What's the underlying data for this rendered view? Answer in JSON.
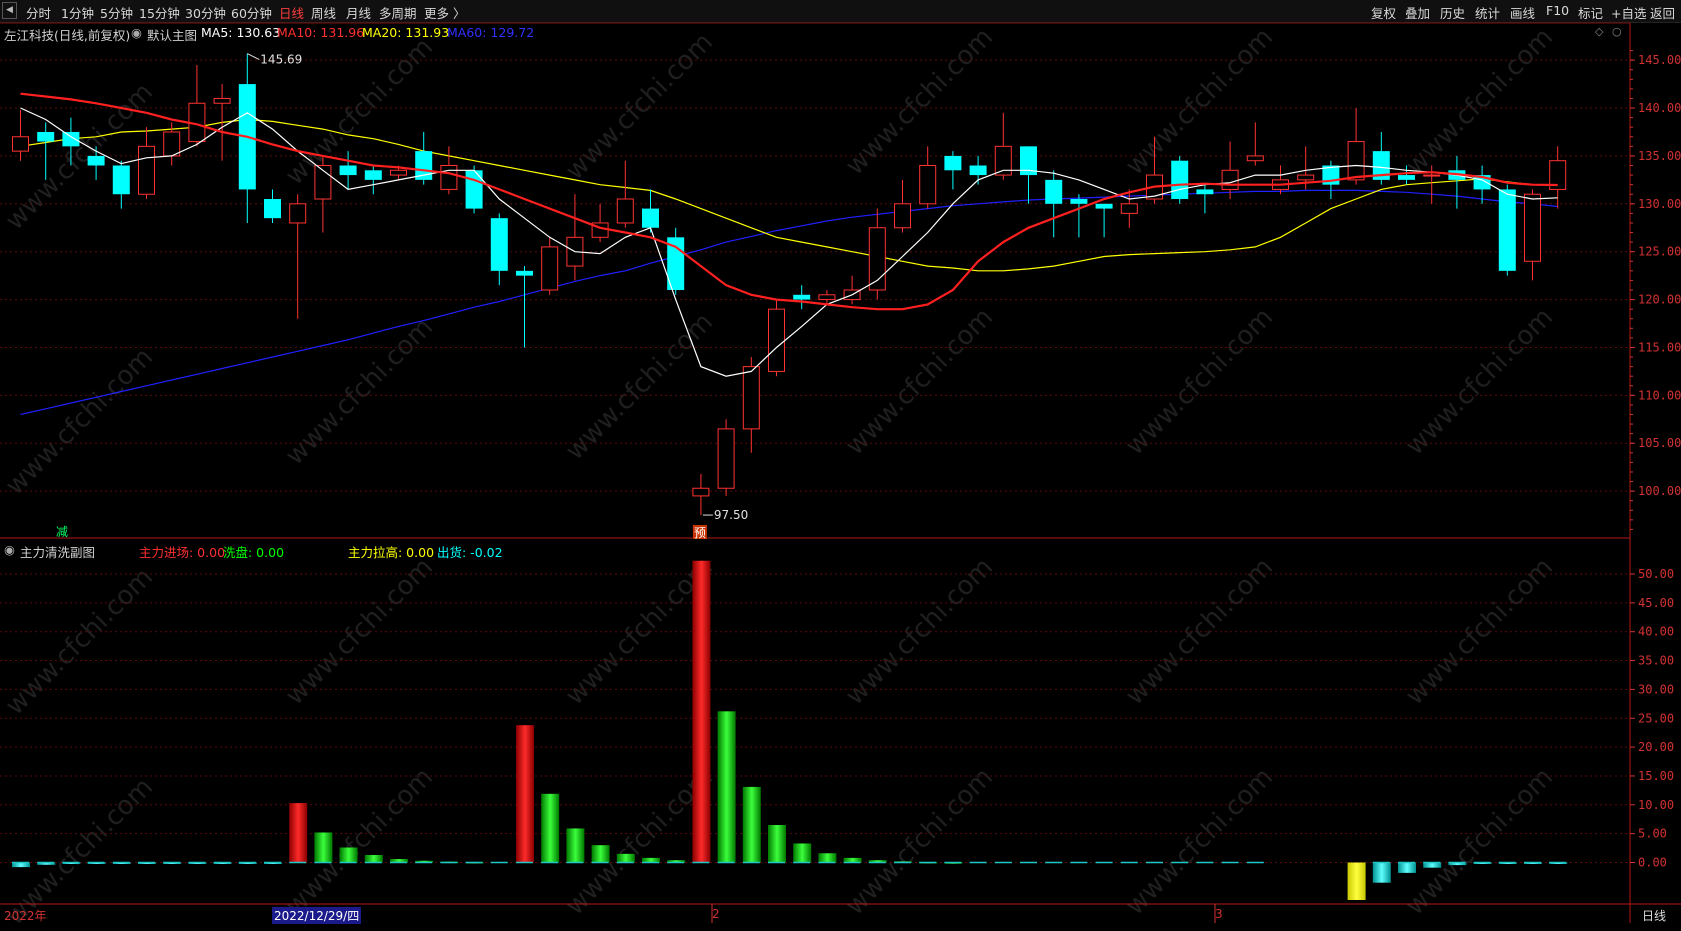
{
  "toolbar": {
    "periods": [
      "分时",
      "1分钟",
      "5分钟",
      "15分钟",
      "30分钟",
      "60分钟",
      "日线",
      "周线",
      "月线",
      "多周期",
      "更多 〉"
    ],
    "active_period": "日线",
    "right_buttons": [
      "复权",
      "叠加",
      "历史",
      "统计",
      "画线",
      "F10",
      "标记",
      "+自选",
      "返回"
    ]
  },
  "main_legend": {
    "title": "左江科技(日线,前复权)",
    "indicator_name": "默认主图",
    "ma5": "MA5: 130.63",
    "ma10": "MA10: 131.96",
    "ma20": "MA20: 131.93",
    "ma60": "MA60: 129.72"
  },
  "sub_legend": {
    "name": "主力清洗副图",
    "enter": "主力进场: 0.00",
    "wash": "洗盘: 0.00",
    "pull": "主力拉高: 0.00",
    "ship": "出货: -0.02"
  },
  "annotations": {
    "high": "145.69",
    "low": "97.50",
    "marker_reduce": "减",
    "marker_pre": "预"
  },
  "bottom_bar": {
    "year": "2022年",
    "selected_date": "2022/12/29/四",
    "month2": "2",
    "month3": "3",
    "period": "日线"
  },
  "colors": {
    "up": "#ff3232",
    "down": "#00ffff",
    "ma5": "#ffffff",
    "ma10": "#ff2020",
    "ma20": "#ffff00",
    "ma60": "#2020ff",
    "green_bar": "#00e000",
    "yellow_bar": "#ffff00",
    "axis": "#d23232"
  },
  "watermark": "www.cfchi.com",
  "chart_data": [
    {
      "type": "candlestick",
      "title": "左江科技(日线,前复权)",
      "ylim": [
        95,
        147
      ],
      "y_ticks": [
        100.0,
        105.0,
        110.0,
        115.0,
        120.0,
        125.0,
        130.0,
        135.0,
        140.0,
        145.0
      ],
      "candles": [
        {
          "o": 135.5,
          "c": 137.0,
          "h": 139.8,
          "l": 134.5
        },
        {
          "o": 137.5,
          "c": 136.5,
          "h": 138.5,
          "l": 132.5
        },
        {
          "o": 137.5,
          "c": 136.0,
          "h": 139.0,
          "l": 134.0
        },
        {
          "o": 135.0,
          "c": 134.0,
          "h": 136.0,
          "l": 132.5
        },
        {
          "o": 134.0,
          "c": 131.0,
          "h": 134.5,
          "l": 129.5
        },
        {
          "o": 131.0,
          "c": 136.0,
          "h": 138.0,
          "l": 130.5
        },
        {
          "o": 135.0,
          "c": 137.5,
          "h": 138.5,
          "l": 134.0
        },
        {
          "o": 136.5,
          "c": 140.5,
          "h": 144.5,
          "l": 136.0
        },
        {
          "o": 140.5,
          "c": 141.0,
          "h": 142.5,
          "l": 134.5
        },
        {
          "o": 142.5,
          "c": 131.5,
          "h": 145.69,
          "l": 128.0
        },
        {
          "o": 130.5,
          "c": 128.5,
          "h": 131.5,
          "l": 128.0
        },
        {
          "o": 128.0,
          "c": 130.0,
          "h": 131.0,
          "l": 118.0
        },
        {
          "o": 130.5,
          "c": 134.0,
          "h": 135.0,
          "l": 127.0
        },
        {
          "o": 134.0,
          "c": 133.0,
          "h": 135.5,
          "l": 131.5
        },
        {
          "o": 133.5,
          "c": 132.5,
          "h": 134.0,
          "l": 131.0
        },
        {
          "o": 133.0,
          "c": 133.5,
          "h": 134.0,
          "l": 132.5
        },
        {
          "o": 135.5,
          "c": 132.5,
          "h": 137.5,
          "l": 132.0
        },
        {
          "o": 131.5,
          "c": 134.0,
          "h": 136.0,
          "l": 131.0
        },
        {
          "o": 133.5,
          "c": 129.5,
          "h": 134.0,
          "l": 129.0
        },
        {
          "o": 128.5,
          "c": 123.0,
          "h": 129.0,
          "l": 121.5
        },
        {
          "o": 123.0,
          "c": 122.5,
          "h": 123.5,
          "l": 115.0
        },
        {
          "o": 121.0,
          "c": 125.5,
          "h": 126.5,
          "l": 120.5
        },
        {
          "o": 123.5,
          "c": 126.5,
          "h": 131.0,
          "l": 122.0
        },
        {
          "o": 126.5,
          "c": 128.0,
          "h": 130.0,
          "l": 126.0
        },
        {
          "o": 128.0,
          "c": 130.5,
          "h": 134.5,
          "l": 127.5
        },
        {
          "o": 129.5,
          "c": 127.5,
          "h": 131.5,
          "l": 127.0
        },
        {
          "o": 126.5,
          "c": 121.0,
          "h": 127.5,
          "l": 120.5
        },
        {
          "o": 99.5,
          "c": 100.3,
          "h": 101.8,
          "l": 97.5
        },
        {
          "o": 100.3,
          "c": 106.5,
          "h": 107.5,
          "l": 99.5
        },
        {
          "o": 106.5,
          "c": 113.0,
          "h": 114.0,
          "l": 104.0
        },
        {
          "o": 112.5,
          "c": 119.0,
          "h": 120.0,
          "l": 112.0
        },
        {
          "o": 120.5,
          "c": 120.0,
          "h": 121.5,
          "l": 119.0
        },
        {
          "o": 120.0,
          "c": 120.5,
          "h": 121.0,
          "l": 119.5
        },
        {
          "o": 120.0,
          "c": 121.0,
          "h": 122.5,
          "l": 119.5
        },
        {
          "o": 121.0,
          "c": 127.5,
          "h": 129.5,
          "l": 120.0
        },
        {
          "o": 127.5,
          "c": 130.0,
          "h": 132.5,
          "l": 127.0
        },
        {
          "o": 130.0,
          "c": 134.0,
          "h": 136.0,
          "l": 129.5
        },
        {
          "o": 135.0,
          "c": 133.5,
          "h": 135.5,
          "l": 131.5
        },
        {
          "o": 134.0,
          "c": 133.0,
          "h": 135.0,
          "l": 132.0
        },
        {
          "o": 133.0,
          "c": 136.0,
          "h": 139.5,
          "l": 132.5
        },
        {
          "o": 136.0,
          "c": 133.0,
          "h": 136.0,
          "l": 130.0
        },
        {
          "o": 132.5,
          "c": 130.0,
          "h": 133.5,
          "l": 126.5
        },
        {
          "o": 130.5,
          "c": 130.0,
          "h": 131.0,
          "l": 126.5
        },
        {
          "o": 130.0,
          "c": 129.5,
          "h": 130.0,
          "l": 126.5
        },
        {
          "o": 129.0,
          "c": 130.0,
          "h": 131.5,
          "l": 127.5
        },
        {
          "o": 130.5,
          "c": 133.0,
          "h": 137.0,
          "l": 130.0
        },
        {
          "o": 134.5,
          "c": 130.5,
          "h": 135.0,
          "l": 130.0
        },
        {
          "o": 131.5,
          "c": 131.0,
          "h": 132.0,
          "l": 129.0
        },
        {
          "o": 131.5,
          "c": 133.5,
          "h": 136.5,
          "l": 130.5
        },
        {
          "o": 134.5,
          "c": 135.0,
          "h": 138.5,
          "l": 134.0
        },
        {
          "o": 131.5,
          "c": 132.5,
          "h": 134.0,
          "l": 131.0
        },
        {
          "o": 132.5,
          "c": 133.0,
          "h": 136.0,
          "l": 131.5
        },
        {
          "o": 134.0,
          "c": 132.0,
          "h": 134.5,
          "l": 130.5
        },
        {
          "o": 132.5,
          "c": 136.5,
          "h": 140.0,
          "l": 132.0
        },
        {
          "o": 135.5,
          "c": 132.5,
          "h": 137.5,
          "l": 132.0
        },
        {
          "o": 133.0,
          "c": 132.5,
          "h": 134.0,
          "l": 132.0
        },
        {
          "o": 133.0,
          "c": 133.0,
          "h": 134.0,
          "l": 130.0
        },
        {
          "o": 133.5,
          "c": 132.5,
          "h": 135.0,
          "l": 129.5
        },
        {
          "o": 133.0,
          "c": 131.5,
          "h": 134.0,
          "l": 130.0
        },
        {
          "o": 131.5,
          "c": 123.0,
          "h": 132.0,
          "l": 122.5
        },
        {
          "o": 124.0,
          "c": 131.0,
          "h": 131.5,
          "l": 122.0
        },
        {
          "o": 131.5,
          "c": 134.5,
          "h": 136.0,
          "l": 129.5
        }
      ],
      "ma5": [
        140,
        138.8,
        137,
        135.5,
        134.2,
        134.8,
        135,
        136.2,
        138,
        139.5,
        137.8,
        135.5,
        133.5,
        131.5,
        132,
        132.5,
        133,
        133.5,
        133.5,
        130.5,
        128.5,
        126.5,
        125,
        124.8,
        126.5,
        127.5,
        120,
        113,
        112,
        112.5,
        115,
        117.2,
        119.5,
        120.5,
        122,
        124.5,
        127,
        130,
        132.5,
        133.5,
        133.5,
        133.2,
        132.5,
        131.5,
        130.5,
        130.8,
        131.5,
        132,
        132.2,
        133,
        133,
        133.5,
        133.8,
        134,
        133.8,
        133.5,
        133.3,
        133,
        132.5,
        131,
        130.5,
        130.63
      ],
      "ma10": [
        141.5,
        141.2,
        140.9,
        140.5,
        140,
        139.5,
        138.8,
        138.3,
        137.5,
        137,
        136.2,
        135.5,
        135,
        134.5,
        134,
        133.8,
        133.5,
        133.2,
        132.5,
        131.5,
        130.5,
        129.5,
        128.5,
        127.5,
        127,
        126.5,
        125.5,
        123.5,
        121.5,
        120.5,
        120,
        119.8,
        119.5,
        119.2,
        119,
        119,
        119.5,
        121,
        124,
        126,
        127.5,
        128.5,
        129.5,
        130.5,
        131.2,
        131.8,
        132,
        132.1,
        132,
        132,
        132,
        132.2,
        132.4,
        132.8,
        133,
        133.2,
        133.3,
        133.1,
        132.8,
        132.2,
        132,
        131.96
      ],
      "ma20": [
        136,
        136.4,
        136.8,
        137,
        137.5,
        137.6,
        137.8,
        138,
        138.5,
        138.8,
        138.6,
        138.2,
        137.8,
        137.2,
        136.8,
        136.2,
        135.5,
        135,
        134.5,
        134,
        133.5,
        133,
        132.5,
        132,
        131.7,
        131.4,
        130.5,
        129.5,
        128.5,
        127.5,
        126.5,
        126,
        125.5,
        125,
        124.5,
        124,
        123.5,
        123.3,
        123,
        123,
        123.2,
        123.5,
        124,
        124.5,
        124.7,
        124.8,
        124.9,
        125,
        125.2,
        125.5,
        126.5,
        128,
        129.5,
        130.5,
        131.5,
        132,
        132.2,
        132.4,
        132.6,
        132.3,
        132,
        131.93
      ],
      "ma60": [
        108,
        108.6,
        109.2,
        109.8,
        110.4,
        111,
        111.6,
        112.2,
        112.8,
        113.4,
        114,
        114.6,
        115.2,
        115.8,
        116.5,
        117.2,
        117.8,
        118.5,
        119.2,
        119.8,
        120.5,
        121.2,
        121.9,
        122.5,
        123,
        123.8,
        124.5,
        125.2,
        126,
        126.6,
        127.2,
        127.7,
        128.2,
        128.6,
        128.9,
        129.2,
        129.5,
        129.8,
        130,
        130.2,
        130.4,
        130.5,
        130.6,
        130.7,
        130.8,
        130.9,
        131,
        131.1,
        131.2,
        131.3,
        131.3,
        131.4,
        131.4,
        131.4,
        131.3,
        131.2,
        131,
        130.8,
        130.5,
        130.2,
        130,
        129.72
      ]
    },
    {
      "type": "bar",
      "title": "主力清洗副图",
      "ylim": [
        -8,
        55
      ],
      "y_ticks": [
        0.0,
        5.0,
        10.0,
        15.0,
        20.0,
        25.0,
        30.0,
        35.0,
        40.0,
        45.0,
        50.0
      ],
      "series": [
        {
          "name": "主力进场",
          "values": [
            0,
            0,
            0,
            0,
            0,
            0,
            0,
            0,
            0,
            0,
            0,
            10.3,
            0,
            0,
            0,
            0,
            0,
            0,
            0,
            0,
            23.8,
            0,
            0,
            0,
            0,
            0,
            0,
            52.3,
            0,
            0,
            0,
            0,
            0,
            0,
            0,
            0,
            0,
            0,
            0,
            0,
            0,
            0,
            0,
            0,
            0,
            0,
            0,
            0,
            0,
            0,
            0,
            0,
            0,
            0,
            0,
            0,
            0,
            0,
            0,
            0,
            0,
            0
          ]
        },
        {
          "name": "洗盘",
          "values": [
            0,
            0,
            0,
            0,
            0,
            0,
            0,
            0,
            0,
            0,
            0,
            0,
            5.2,
            2.6,
            1.3,
            0.6,
            0.3,
            0.15,
            0.1,
            0,
            0,
            11.9,
            5.9,
            3.0,
            1.5,
            0.8,
            0.4,
            0,
            26.2,
            13.1,
            6.5,
            3.3,
            1.6,
            0.8,
            0.4,
            0.2,
            0.1,
            0.05,
            0,
            0,
            0,
            0,
            0,
            0,
            0,
            0,
            0,
            0,
            0,
            0,
            0,
            0,
            0,
            0,
            0,
            0,
            0,
            0,
            0,
            0,
            0,
            0
          ]
        },
        {
          "name": "主力拉高",
          "values": [
            0,
            0,
            0,
            0,
            0,
            0,
            0,
            0,
            0,
            0,
            0,
            0,
            0,
            0,
            0,
            0,
            0,
            0,
            0,
            0,
            0,
            0,
            0,
            0,
            0,
            0,
            0,
            0,
            0,
            0,
            0,
            0,
            0,
            0,
            0,
            0,
            0,
            0,
            0,
            0,
            0,
            0,
            0,
            0,
            0,
            0,
            0,
            0,
            0,
            0,
            0,
            0,
            0,
            -6.5,
            0,
            0,
            0,
            0,
            0,
            0,
            0,
            0
          ]
        },
        {
          "name": "出货",
          "values": [
            -0.8,
            -0.4,
            -0.2,
            -0.1,
            -0.05,
            -0.03,
            -0.02,
            -0.01,
            -0.01,
            -0.01,
            -0.01,
            0,
            0,
            0,
            0,
            0,
            0,
            0,
            0,
            0,
            0,
            0,
            0,
            0,
            0,
            0,
            0,
            0,
            0,
            0,
            0,
            0,
            0,
            0,
            0,
            0,
            0,
            0,
            0,
            0,
            0,
            0,
            0,
            0,
            0,
            0,
            0,
            0,
            0,
            0,
            0,
            0,
            0,
            0,
            -3.5,
            -1.8,
            -0.9,
            -0.45,
            -0.22,
            -0.11,
            -0.05,
            -0.02
          ]
        }
      ]
    }
  ]
}
